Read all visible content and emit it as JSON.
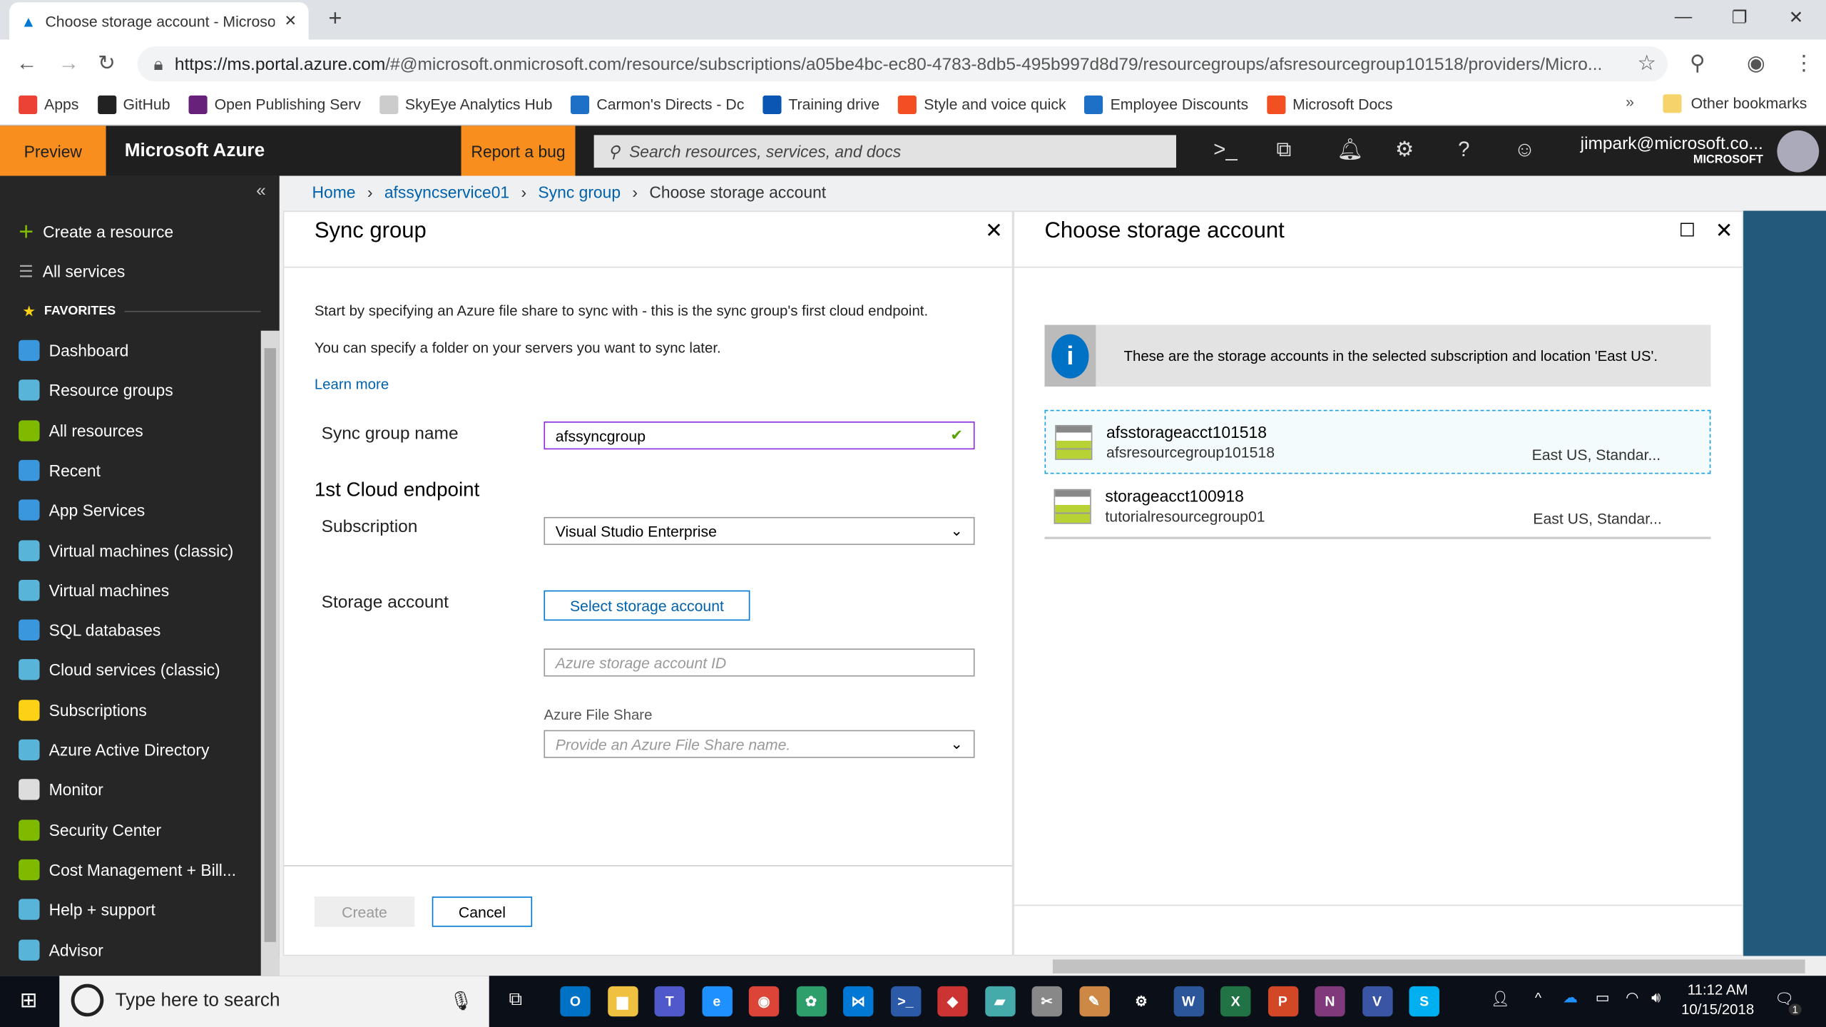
{
  "browser": {
    "tab_title": "Choose storage account - Microsoft Azure",
    "url_host": "https://ms.portal.azure.com",
    "url_rest": "/#@microsoft.onmicrosoft.com/resource/subscriptions/a05be4bc-ec80-4783-8db5-495b997d8d79/resourcegroups/afsresourcegroup101518/providers/Micro...",
    "bookmarks": [
      {
        "label": "Apps",
        "color": "#ea4335"
      },
      {
        "label": "GitHub",
        "color": "#222222"
      },
      {
        "label": "Open Publishing Serv",
        "color": "#68217a"
      },
      {
        "label": "SkyEye Analytics Hub",
        "color": "#cccccc"
      },
      {
        "label": "Carmon's Directs - Dc",
        "color": "#1e6fc6"
      },
      {
        "label": "Training drive",
        "color": "#0b56b3"
      },
      {
        "label": "Style and voice quick",
        "color": "#f25022"
      },
      {
        "label": "Employee Discounts",
        "color": "#1e6fc6"
      },
      {
        "label": "Microsoft Docs",
        "color": "#f25022"
      }
    ],
    "more": "»",
    "other_bookmarks": "Other bookmarks"
  },
  "portal": {
    "preview": "Preview",
    "brand": "Microsoft Azure",
    "report_bug": "Report a bug",
    "search_placeholder": "Search resources, services, and docs",
    "user": "jimpark@microsoft.co...",
    "tenant": "MICROSOFT",
    "accent": "#f78e1e"
  },
  "sidebar": {
    "collapse": "«",
    "create": "Create a resource",
    "all_services": "All services",
    "favorites": "FAVORITES",
    "items": [
      {
        "label": "Dashboard",
        "color": "#3a96dd"
      },
      {
        "label": "Resource groups",
        "color": "#59b4d9"
      },
      {
        "label": "All resources",
        "color": "#7fba00"
      },
      {
        "label": "Recent",
        "color": "#3a96dd"
      },
      {
        "label": "App Services",
        "color": "#3a96dd"
      },
      {
        "label": "Virtual machines (classic)",
        "color": "#59b4d9"
      },
      {
        "label": "Virtual machines",
        "color": "#59b4d9"
      },
      {
        "label": "SQL databases",
        "color": "#3a96dd"
      },
      {
        "label": "Cloud services (classic)",
        "color": "#59b4d9"
      },
      {
        "label": "Subscriptions",
        "color": "#fcd116"
      },
      {
        "label": "Azure Active Directory",
        "color": "#59b4d9"
      },
      {
        "label": "Monitor",
        "color": "#dddddd"
      },
      {
        "label": "Security Center",
        "color": "#7fba00"
      },
      {
        "label": "Cost Management + Bill...",
        "color": "#7fba00"
      },
      {
        "label": "Help + support",
        "color": "#59b4d9"
      },
      {
        "label": "Advisor",
        "color": "#59b4d9"
      }
    ]
  },
  "breadcrumb": [
    "Home",
    "afssyncservice01",
    "Sync group",
    "Choose storage account"
  ],
  "sync_blade": {
    "title": "Sync group",
    "intro1": "Start by specifying an Azure file share to sync with - this is the sync group's first cloud endpoint.",
    "intro2": "You can specify a folder on your servers you want to sync later.",
    "learn_more": "Learn more",
    "name_label": "Sync group name",
    "name_value": "afssyncgroup",
    "section": "1st Cloud endpoint",
    "subscription_label": "Subscription",
    "subscription_value": "Visual Studio Enterprise",
    "storage_label": "Storage account",
    "select_button": "Select storage account",
    "storage_id_placeholder": "Azure storage account ID",
    "share_label": "Azure File Share",
    "share_placeholder": "Provide an Azure File Share name.",
    "create": "Create",
    "cancel": "Cancel"
  },
  "storage_blade": {
    "title": "Choose storage account",
    "info": "These are the storage accounts in the selected subscription and location 'East US'.",
    "accounts": [
      {
        "name": "afsstorageacct101518",
        "group": "afsresourcegroup101518",
        "meta": "East US, Standar..."
      },
      {
        "name": "storageacct100918",
        "group": "tutorialresourcegroup01",
        "meta": "East US, Standar..."
      }
    ]
  },
  "taskbar": {
    "search": "Type here to search",
    "time": "11:12 AM",
    "date": "10/15/2018",
    "notifications": "1",
    "apps": [
      {
        "label": "O",
        "color": "#0072c6"
      },
      {
        "label": "▆",
        "color": "#f0c040"
      },
      {
        "label": "T",
        "color": "#5059c9"
      },
      {
        "label": "e",
        "color": "#1e90ff"
      },
      {
        "label": "◉",
        "color": "#db4437"
      },
      {
        "label": "✿",
        "color": "#2e9e6a"
      },
      {
        "label": "⋈",
        "color": "#0078d4"
      },
      {
        "label": ">_",
        "color": "#2a5aa8"
      },
      {
        "label": "◆",
        "color": "#c33"
      },
      {
        "label": "▰",
        "color": "#4aa"
      },
      {
        "label": "✂",
        "color": "#888"
      },
      {
        "label": "✎",
        "color": "#c84"
      },
      {
        "label": "⚙",
        "color": "#0b0f17"
      },
      {
        "label": "W",
        "color": "#2b579a"
      },
      {
        "label": "X",
        "color": "#217346"
      },
      {
        "label": "P",
        "color": "#d24726"
      },
      {
        "label": "N",
        "color": "#80397b"
      },
      {
        "label": "V",
        "color": "#3955a3"
      },
      {
        "label": "S",
        "color": "#00aff0"
      }
    ]
  }
}
